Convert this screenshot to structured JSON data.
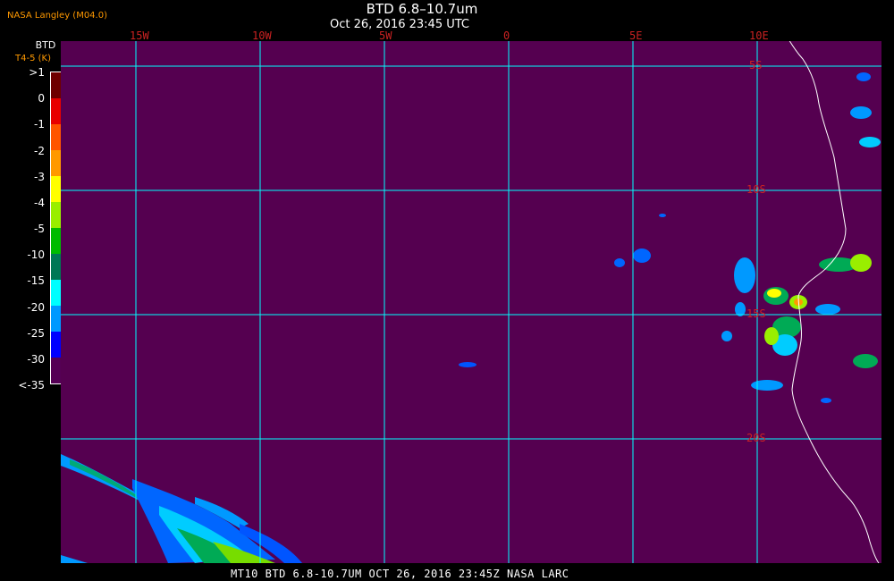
{
  "header": {
    "credit": "NASA Langley (M04.0)",
    "title": "BTD 6.8–10.7um",
    "subtitle": "Oct 26, 2016 23:45 UTC"
  },
  "legend": {
    "title": "BTD",
    "subtitle": "T4-5 (K)",
    "ticks": [
      ">1",
      "0",
      "-1",
      "-2",
      "-3",
      "-4",
      "-5",
      "-10",
      "-15",
      "-20",
      "-25",
      "-30",
      "<-35"
    ],
    "colors": [
      "#6e0000",
      "#e80000",
      "#ff5500",
      "#ff9900",
      "#ffff00",
      "#99ee00",
      "#00bb00",
      "#007755",
      "#00ffff",
      "#0099ff",
      "#0000ff",
      "#550055"
    ]
  },
  "map": {
    "lon_labels": [
      "15W",
      "10W",
      "5W",
      "0",
      "5E",
      "10E"
    ],
    "lat_labels": [
      "5S",
      "10S",
      "15S",
      "20S"
    ],
    "background_color": "#550050",
    "grid_color": "#00ffff",
    "coast_color": "#ffffff"
  },
  "footer": {
    "text": "MT10  BTD 6.8-10.7UM   OCT 26, 2016 23:45Z   NASA LARC"
  }
}
